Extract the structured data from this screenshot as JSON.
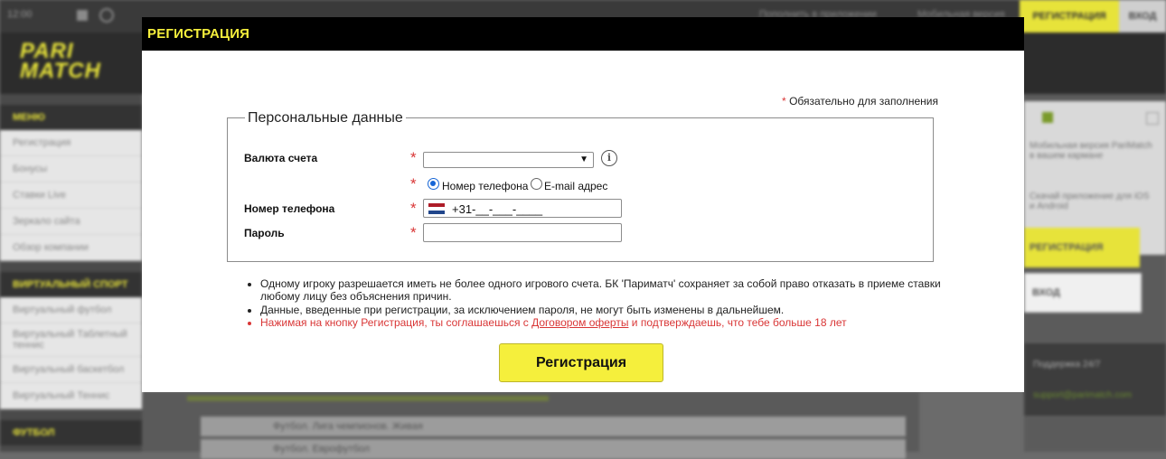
{
  "background": {
    "topbar": {
      "time": "12:00",
      "link_1": "Пополнить в приложении",
      "link_2": "Мобильная версия",
      "register": "РЕГИСТРАЦИЯ",
      "login": "ВХОД"
    },
    "logo": {
      "line1": "PARI",
      "line2": "MATCH"
    },
    "sidebar": {
      "header_1": "МЕНЮ",
      "items_1": [
        "Регистрация",
        "Бонусы",
        "Ставки Live",
        "Зеркало сайта",
        "Обзор компании"
      ],
      "header_2": "ВИРТУАЛЬНЫЙ СПОРТ",
      "items_2": [
        "Виртуальный футбол",
        "Виртуальный Таблетный теннис",
        "Виртуальный баскетбол",
        "Виртуальный Теннис"
      ],
      "header_3": "ФУТБОЛ"
    },
    "center_rows": [
      "Футбол. Лига чемпионов. Живая",
      "Футбол. Еврофутбол"
    ],
    "right": {
      "text_1": "Мобильная версия PariMatch в вашем кармане",
      "text_2": "Скачай приложение для iOS и Android",
      "yellow_button": "РЕГИСТРАЦИЯ",
      "white_button": "ВХОД",
      "dark_text_1": "Поддержка 24/7",
      "dark_text_2": "support@parimatch.com"
    }
  },
  "modal": {
    "title": "РЕГИСТРАЦИЯ",
    "required_note": "Обязательно для заполнения",
    "required_star": "*",
    "legend": "Персональные данные",
    "fields": {
      "currency_label": "Валюта счета",
      "currency_value": "",
      "radio_phone": "Номер телефона",
      "radio_email": "E-mail адрес",
      "phone_label": "Номер телефона",
      "phone_value": "+31-__-___-____",
      "password_label": "Пароль",
      "password_value": ""
    },
    "notes": {
      "note_1": "Одному игроку разрешается иметь не более одного игрового счета. БК 'Париматч' сохраняет за собой право отказать в приеме ставки любому лицу без объяснения причин.",
      "note_2": "Данные, введенные при регистрации, за исключением пароля, не могут быть изменены в дальнейшем.",
      "note_3_prefix": "Нажимая на кнопку Регистрация, ты соглашаешься с ",
      "note_3_link": "Договором оферты",
      "note_3_suffix": " и подтверждаешь, что тебе больше 18 лет"
    },
    "submit_label": "Регистрация"
  },
  "colors": {
    "accent_yellow": "#f5ef3c",
    "required_red": "#d93636",
    "header_black": "#000000",
    "radio_blue": "#1766d6"
  },
  "icons": {
    "info": "info-icon",
    "select_chevron": "chevron-down-icon",
    "flag": "netherlands-flag-icon"
  }
}
